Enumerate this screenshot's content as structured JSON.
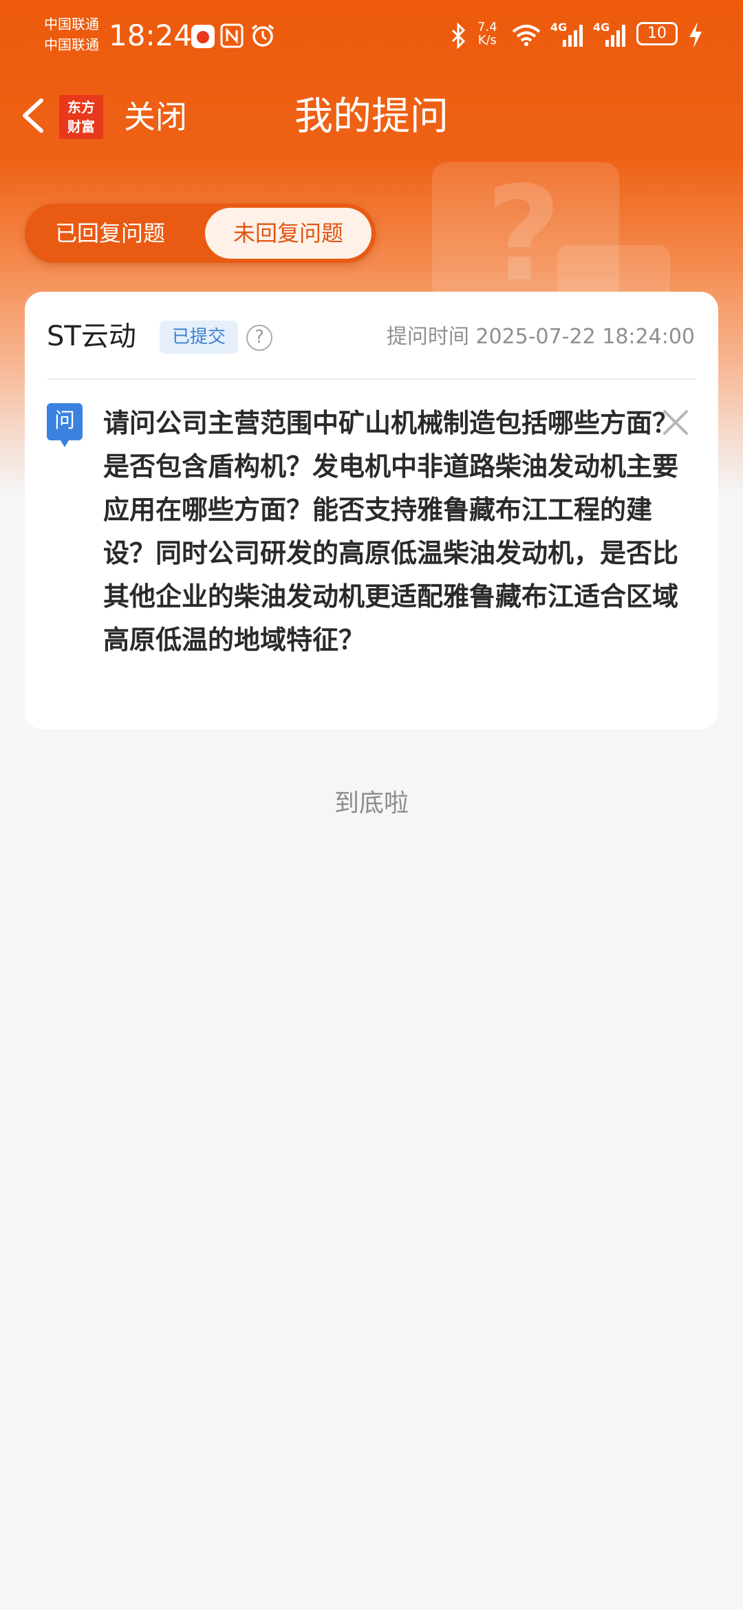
{
  "status_bar": {
    "carrier_1": "中国联通",
    "carrier_2": "中国联通",
    "time": "18:24",
    "net_speed_value": "7.4",
    "net_speed_unit": "K/s",
    "signal_1": "4G",
    "signal_2": "4G",
    "battery": "10",
    "icons": [
      "huawei-app-icon",
      "nfc-icon",
      "alarm-icon",
      "bluetooth-icon",
      "wifi-icon",
      "signal-icon",
      "charging-icon"
    ]
  },
  "header": {
    "logo_line1": "东方",
    "logo_line2": "财富",
    "close_label": "关闭",
    "title": "我的提问"
  },
  "tabs": [
    {
      "label": "已回复问题",
      "active": false
    },
    {
      "label": "未回复问题",
      "active": true
    }
  ],
  "card": {
    "company": "ST云动",
    "status_badge": "已提交",
    "help_symbol": "?",
    "ask_time_label": "提问时间",
    "ask_time": "2025-07-22 18:24:00",
    "question_icon_text": "问",
    "question": "请问公司主营范围中矿山机械制造包括哪些方面？是否包含盾构机？发电机中非道路柴油发动机主要应用在哪些方面？能否支持雅鲁藏布江工程的建设？同时公司研发的高原低温柴油发动机，是否比其他企业的柴油发动机更适配雅鲁藏布江适合区域高原低温的地域特征？"
  },
  "footer": {
    "end_text": "到底啦"
  },
  "colors": {
    "accent": "#ed5a0c",
    "tab_active_text": "#e25512",
    "badge_bg": "#e6f0fb",
    "badge_text": "#3a7fd0",
    "question_icon": "#3b82e0"
  }
}
